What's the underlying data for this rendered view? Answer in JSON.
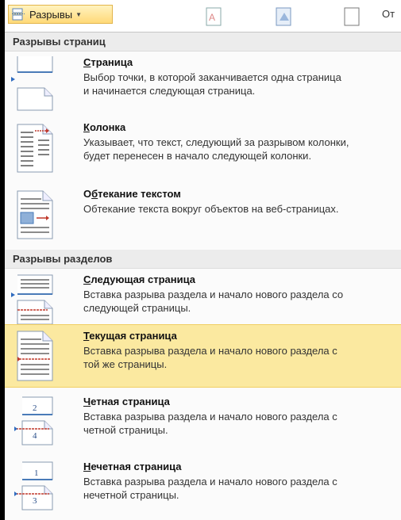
{
  "toolbar": {
    "breaks_label": "Разрывы",
    "next_text": "От"
  },
  "page_breaks": {
    "header": "Разрывы страниц",
    "items": [
      {
        "title_key": "С",
        "title_rest": "траница",
        "desc": "Выбор точки, в которой заканчивается одна страница\nи начинается следующая страница.",
        "icon": "page-break-icon"
      },
      {
        "title_key": "К",
        "title_rest": "олонка",
        "desc": "Указывает, что текст, следующий за разрывом колонки,\nбудет перенесен в начало следующей колонки.",
        "icon": "column-break-icon"
      },
      {
        "title_pre": "О",
        "title_key": "б",
        "title_rest": "текание текстом",
        "desc": "Обтекание текста вокруг объектов на веб-страницах.",
        "icon": "text-wrap-icon"
      }
    ]
  },
  "section_breaks": {
    "header": "Разрывы разделов",
    "items": [
      {
        "title_key": "С",
        "title_rest": "ледующая страница",
        "desc": "Вставка разрыва раздела и начало нового раздела со\nследующей страницы.",
        "icon": "next-page-section-icon"
      },
      {
        "title_key": "Т",
        "title_rest": "екущая страница",
        "desc": "Вставка разрыва раздела и начало нового раздела с\nтой же страницы.",
        "icon": "continuous-section-icon",
        "highlighted": true
      },
      {
        "title_key": "Ч",
        "title_rest": "етная страница",
        "desc": "Вставка разрыва раздела и начало нового раздела с\nчетной страницы.",
        "icon": "even-page-section-icon",
        "num_top": "2",
        "num_bottom": "4"
      },
      {
        "title_key": "Н",
        "title_rest": "ечетная страница",
        "desc": "Вставка разрыва раздела и начало нового раздела с\nнечетной страницы.",
        "icon": "odd-page-section-icon",
        "num_top": "1",
        "num_bottom": "3"
      }
    ]
  },
  "colors": {
    "highlight": "#fbe9a0",
    "accent_red": "#c0392b",
    "doc_blue": "#4a7bb8"
  }
}
